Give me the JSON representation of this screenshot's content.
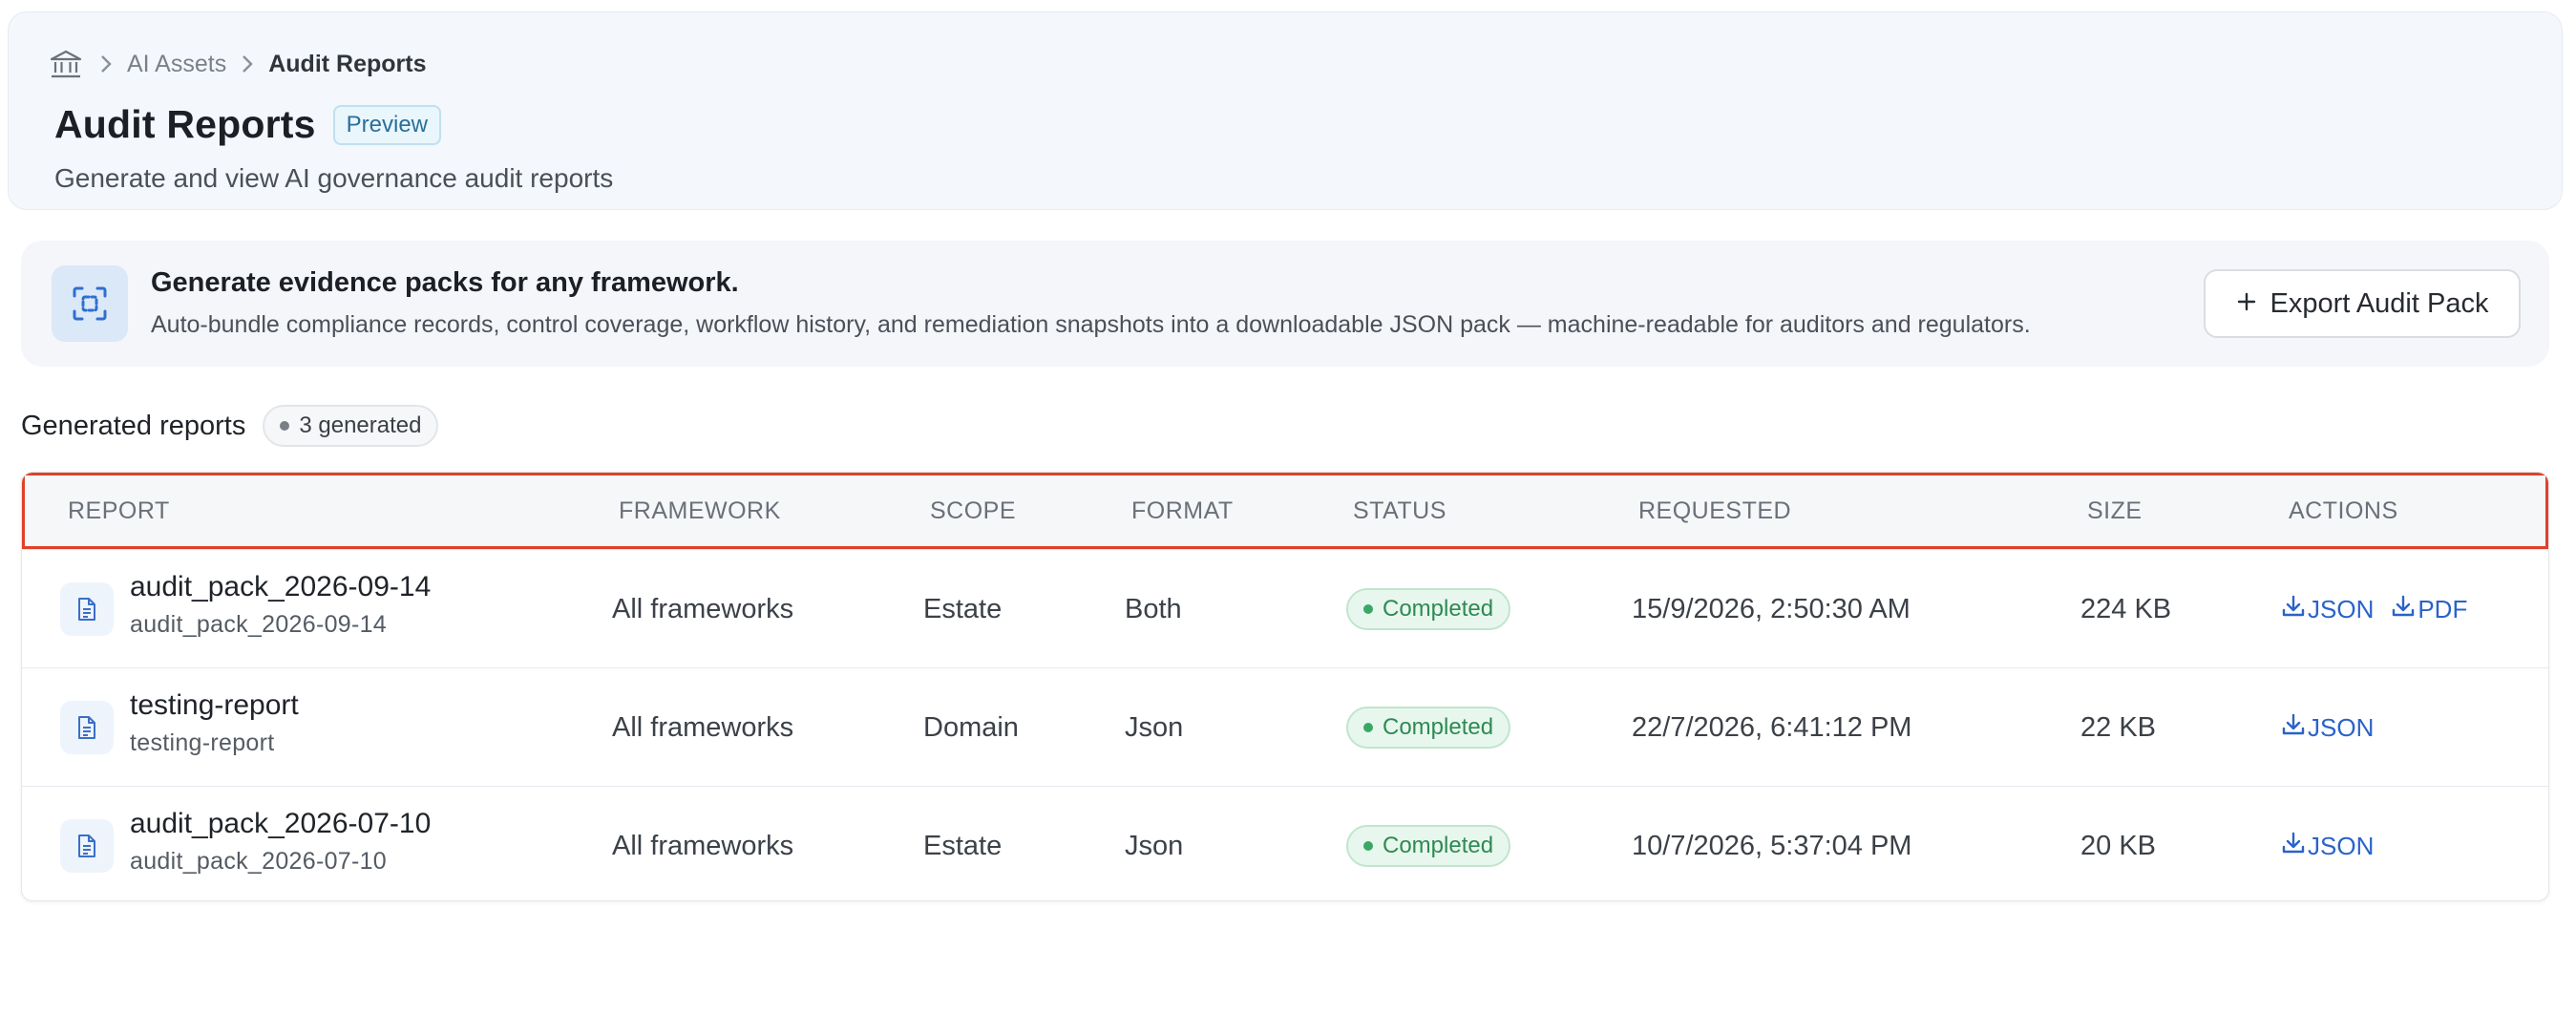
{
  "breadcrumb": {
    "items": [
      "AI Assets",
      "Audit Reports"
    ]
  },
  "header": {
    "title": "Audit Reports",
    "badge": "Preview",
    "subtitle": "Generate and view AI governance audit reports"
  },
  "promo": {
    "title": "Generate evidence packs for any framework.",
    "description": "Auto-bundle compliance records, control coverage, workflow history, and remediation snapshots into a downloadable JSON pack — machine-readable for auditors and regulators.",
    "button_label": "Export Audit Pack"
  },
  "section": {
    "title": "Generated reports",
    "count": "3 generated"
  },
  "table": {
    "columns": [
      "REPORT",
      "FRAMEWORK",
      "SCOPE",
      "FORMAT",
      "STATUS",
      "REQUESTED",
      "SIZE",
      "ACTIONS"
    ],
    "rows": [
      {
        "name": "audit_pack_2026-09-14",
        "sub": "audit_pack_2026-09-14",
        "framework": "All frameworks",
        "scope": "Estate",
        "format": "Both",
        "status": "Completed",
        "requested": "15/9/2026, 2:50:30 AM",
        "size": "224 KB",
        "actions": [
          "JSON",
          "PDF"
        ]
      },
      {
        "name": "testing-report",
        "sub": "testing-report",
        "framework": "All frameworks",
        "scope": "Domain",
        "format": "Json",
        "status": "Completed",
        "requested": "22/7/2026, 6:41:12 PM",
        "size": "22 KB",
        "actions": [
          "JSON"
        ]
      },
      {
        "name": "audit_pack_2026-07-10",
        "sub": "audit_pack_2026-07-10",
        "framework": "All frameworks",
        "scope": "Estate",
        "format": "Json",
        "status": "Completed",
        "requested": "10/7/2026, 5:37:04 PM",
        "size": "20 KB",
        "actions": [
          "JSON"
        ]
      }
    ]
  },
  "colors": {
    "accent": "#2a63c9",
    "status_completed": "#2e8a52",
    "highlight_border": "#e0412a"
  },
  "icons": {
    "home": "bank-building-icon",
    "promo": "scan-frame-icon",
    "export": "plus-icon",
    "file": "file-text-icon",
    "download": "download-icon"
  }
}
